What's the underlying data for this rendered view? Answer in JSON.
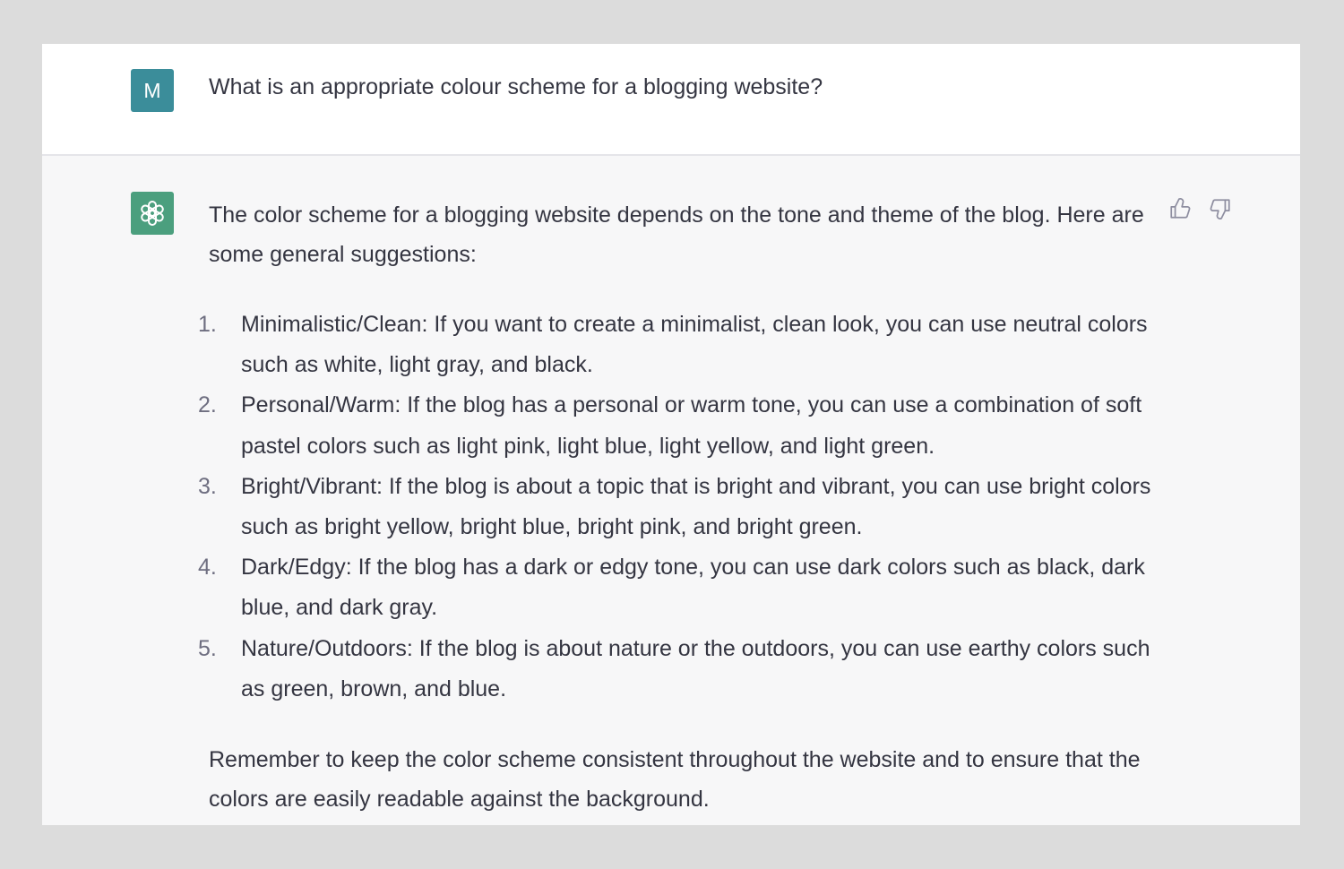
{
  "user_message": {
    "avatar_initial": "M",
    "text": "What is an appropriate colour scheme for a blogging website?"
  },
  "assistant_message": {
    "intro": "The color scheme for a blogging website depends on the tone and theme of the blog. Here are some general suggestions:",
    "items": [
      {
        "number": "1.",
        "text": "Minimalistic/Clean: If you want to create a minimalist, clean look, you can use neutral colors such as white, light gray, and black."
      },
      {
        "number": "2.",
        "text": "Personal/Warm: If the blog has a personal or warm tone, you can use a combination of soft pastel colors such as light pink, light blue, light yellow, and light green."
      },
      {
        "number": "3.",
        "text": "Bright/Vibrant: If the blog is about a topic that is bright and vibrant, you can use bright colors such as bright yellow, bright blue, bright pink, and bright green."
      },
      {
        "number": "4.",
        "text": "Dark/Edgy: If the blog has a dark or edgy tone, you can use dark colors such as black, dark blue, and dark gray."
      },
      {
        "number": "5.",
        "text": "Nature/Outdoors: If the blog is about nature or the outdoors, you can use earthy colors such as green, brown, and blue."
      }
    ],
    "conclusion": "Remember to keep the color scheme consistent throughout the website and to ensure that the colors are easily readable against the background."
  },
  "icons": {
    "assistant_avatar": "openai-logo-icon",
    "thumbs_up": "thumbs-up-icon",
    "thumbs_down": "thumbs-down-icon"
  },
  "colors": {
    "user_avatar_bg": "#3b8d9a",
    "assistant_avatar_bg": "#4b9f7e",
    "text": "#343541",
    "assistant_row_bg": "#f7f7f8"
  }
}
